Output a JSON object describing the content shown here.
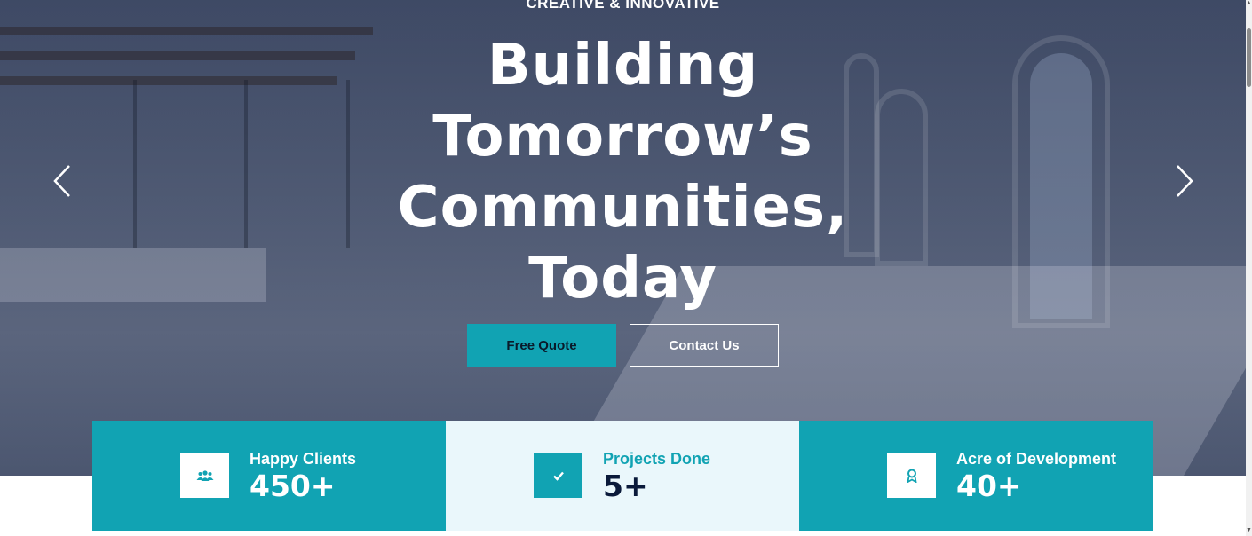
{
  "hero": {
    "eyebrow": "CREATIVE & INNOVATIVE",
    "headline_lines": [
      "Building",
      "Tomorrow’s",
      "Communities,",
      "Today"
    ],
    "buttons": {
      "quote": "Free Quote",
      "contact": "Contact Us"
    },
    "prev_icon": "chevron-left-icon",
    "next_icon": "chevron-right-icon"
  },
  "stats": [
    {
      "label": "Happy Clients",
      "value": "450+",
      "icon": "users-icon"
    },
    {
      "label": "Projects Done",
      "value": "5+",
      "icon": "check-icon"
    },
    {
      "label": "Acre of Development",
      "value": "40+",
      "icon": "award-icon"
    }
  ],
  "colors": {
    "accent": "#11a3b3",
    "light_panel": "#eaf7fb",
    "dark_text": "#0a1a3a"
  }
}
